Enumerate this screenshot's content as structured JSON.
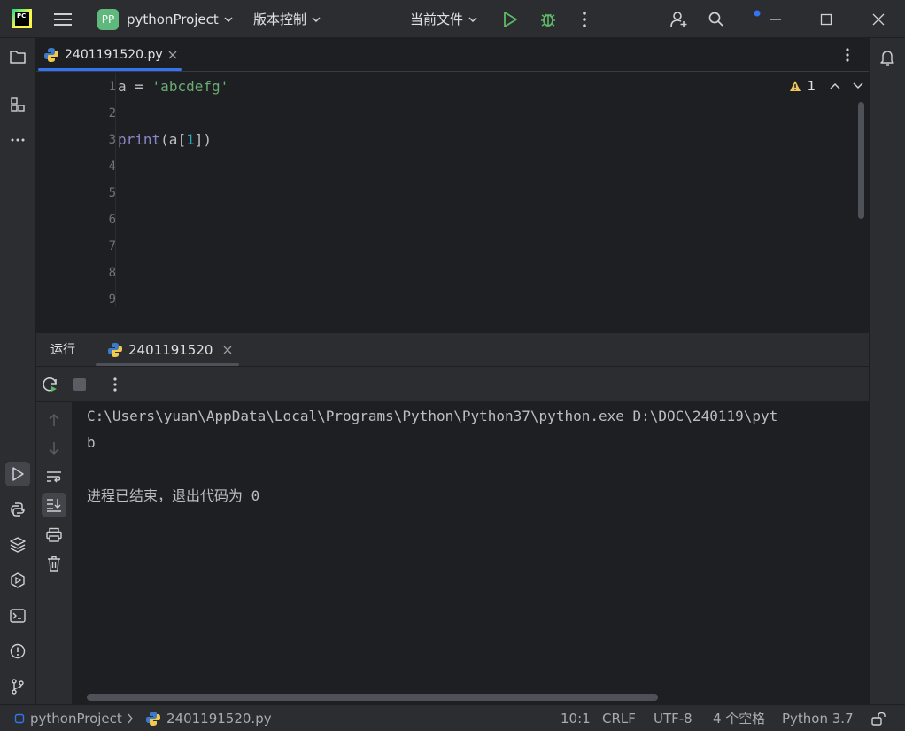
{
  "titlebar": {
    "logo_text": "PC",
    "project_badge": "PP",
    "project_name": "pythonProject",
    "vcs_label": "版本控制",
    "run_config": "当前文件"
  },
  "editor": {
    "tab_filename": "2401191520.py",
    "warning_count": "1",
    "line_numbers": [
      "1",
      "2",
      "3",
      "4",
      "5",
      "6",
      "7",
      "8",
      "9"
    ],
    "code": {
      "line1": {
        "var": "a",
        "op": " = ",
        "str": "'abcdefg'"
      },
      "line3": {
        "func": "print",
        "open": "(a[",
        "num": "1",
        "close": "])"
      }
    }
  },
  "run_window": {
    "title": "运行",
    "tab_label": "2401191520",
    "output": [
      "C:\\Users\\yuan\\AppData\\Local\\Programs\\Python\\Python37\\python.exe D:\\DOC\\240119\\pyt",
      "b",
      "",
      "进程已结束，退出代码为 0"
    ]
  },
  "statusbar": {
    "project": "pythonProject",
    "file": "2401191520.py",
    "position": "10:1",
    "line_sep": "CRLF",
    "encoding": "UTF-8",
    "indent": "4 个空格",
    "interpreter": "Python 3.7"
  }
}
